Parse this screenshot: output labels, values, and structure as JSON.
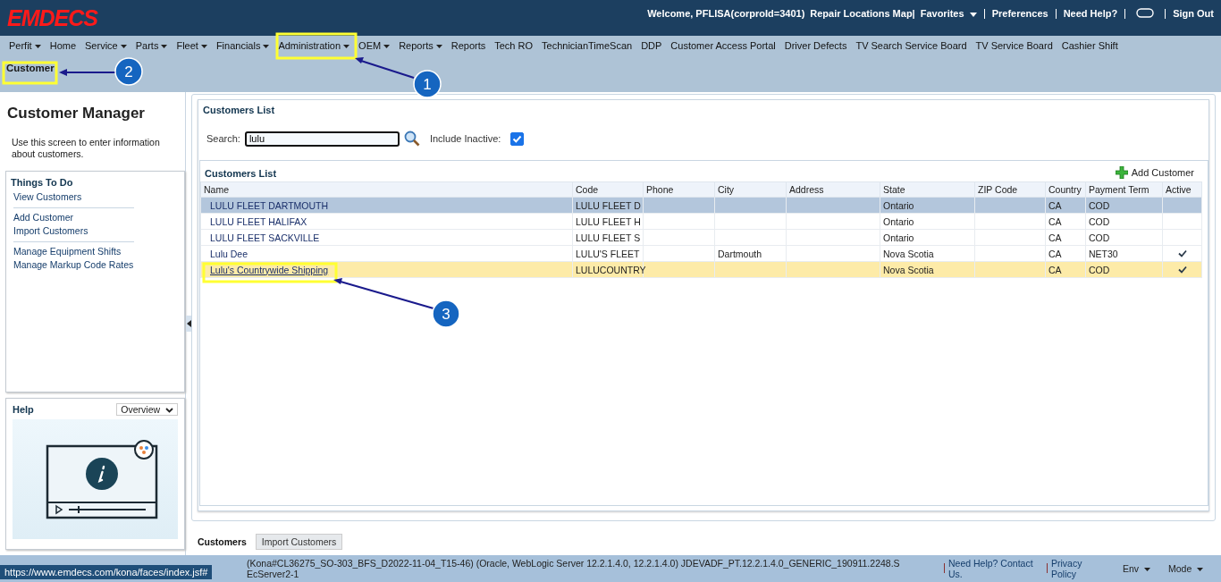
{
  "header": {
    "logo": "EMDECS",
    "welcome": "Welcome, PFLISA(corproId=3401)",
    "links": [
      {
        "label": "Repair Locations Map|",
        "kind": "link"
      },
      {
        "label": "Favorites",
        "kind": "menu"
      },
      {
        "label": "Preferences",
        "kind": "link"
      },
      {
        "label": "Need Help?",
        "kind": "link"
      },
      {
        "kind": "chat"
      },
      {
        "label": "Sign Out",
        "kind": "link"
      }
    ]
  },
  "nav": [
    {
      "label": "Perfit",
      "has_menu": true
    },
    {
      "label": "Home",
      "has_menu": false
    },
    {
      "label": "Service",
      "has_menu": true
    },
    {
      "label": "Parts",
      "has_menu": true
    },
    {
      "label": "Fleet",
      "has_menu": true
    },
    {
      "label": "Financials",
      "has_menu": true
    },
    {
      "label": "Administration",
      "has_menu": true
    },
    {
      "label": "OEM",
      "has_menu": true
    },
    {
      "label": "Reports",
      "has_menu": true
    },
    {
      "label": "Reports",
      "has_menu": false
    },
    {
      "label": "Tech RO",
      "has_menu": false
    },
    {
      "label": "TechnicianTimeScan",
      "has_menu": false
    },
    {
      "label": "DDP",
      "has_menu": false
    },
    {
      "label": "Customer Access Portal",
      "has_menu": false
    },
    {
      "label": "Driver Defects",
      "has_menu": false
    },
    {
      "label": "TV Search Service Board",
      "has_menu": false
    },
    {
      "label": "TV Service Board",
      "has_menu": false
    },
    {
      "label": "Cashier Shift",
      "has_menu": false
    }
  ],
  "breadcrumb": "Customer",
  "sidebar": {
    "title": "Customer Manager",
    "description": "Use this screen to enter information about customers.",
    "things_title": "Things To Do",
    "groups": [
      [
        "View Customers"
      ],
      [
        "Add Customer",
        "Import Customers"
      ],
      [
        "Manage Equipment Shifts",
        "Manage Markup Code Rates"
      ]
    ],
    "help_title": "Help",
    "help_select": "Overview"
  },
  "panel": {
    "title": "Customers List",
    "search_label": "Search:",
    "search_value": "lulu",
    "include_inactive_label": "Include Inactive:",
    "include_inactive": true,
    "table_title": "Customers List",
    "add_button": "Add Customer",
    "columns": [
      "Name",
      "Code",
      "Phone",
      "City",
      "Address",
      "State",
      "ZIP Code",
      "Country",
      "Payment Term",
      "Active"
    ],
    "rows": [
      {
        "name": "LULU FLEET DARTMOUTH",
        "code": "LULU FLEET D",
        "phone": "",
        "city": "",
        "address": "",
        "state": "Ontario",
        "zip": "",
        "country": "CA",
        "term": "COD",
        "active": false,
        "selected": true,
        "hovered": false
      },
      {
        "name": "LULU FLEET HALIFAX",
        "code": "LULU FLEET H",
        "phone": "",
        "city": "",
        "address": "",
        "state": "Ontario",
        "zip": "",
        "country": "CA",
        "term": "COD",
        "active": false,
        "selected": false,
        "hovered": false
      },
      {
        "name": "LULU FLEET SACKVILLE",
        "code": "LULU FLEET S",
        "phone": "",
        "city": "",
        "address": "",
        "state": "Ontario",
        "zip": "",
        "country": "CA",
        "term": "COD",
        "active": false,
        "selected": false,
        "hovered": false
      },
      {
        "name": "Lulu Dee",
        "code": "LULU'S FLEET",
        "phone": "",
        "city": "Dartmouth",
        "address": "",
        "state": "Nova Scotia",
        "zip": "",
        "country": "CA",
        "term": "NET30",
        "active": true,
        "selected": false,
        "hovered": false
      },
      {
        "name": "Lulu's Countrywide Shipping",
        "code": "LULUCOUNTRY",
        "phone": "",
        "city": "",
        "address": "",
        "state": "Nova Scotia",
        "zip": "",
        "country": "CA",
        "term": "COD",
        "active": true,
        "selected": false,
        "hovered": true
      }
    ]
  },
  "tabs": [
    {
      "label": "Customers",
      "selected": true
    },
    {
      "label": "Import Customers",
      "selected": false
    }
  ],
  "footer": {
    "info": "(Kona#CL36275_SO-303_BFS_D2022-11-04_T15-46) (Oracle, WebLogic Server 12.2.1.4.0, 12.2.1.4.0) JDEVADF_PT.12.2.1.4.0_GENERIC_190911.2248.S EcServer2-1",
    "help": "Need Help? Contact Us.",
    "privacy": "Privacy Policy",
    "menus": [
      "Env",
      "Mode"
    ]
  },
  "status_url": "https://www.emdecs.com/kona/faces/index.jsf#",
  "callouts": [
    "1",
    "2",
    "3"
  ]
}
